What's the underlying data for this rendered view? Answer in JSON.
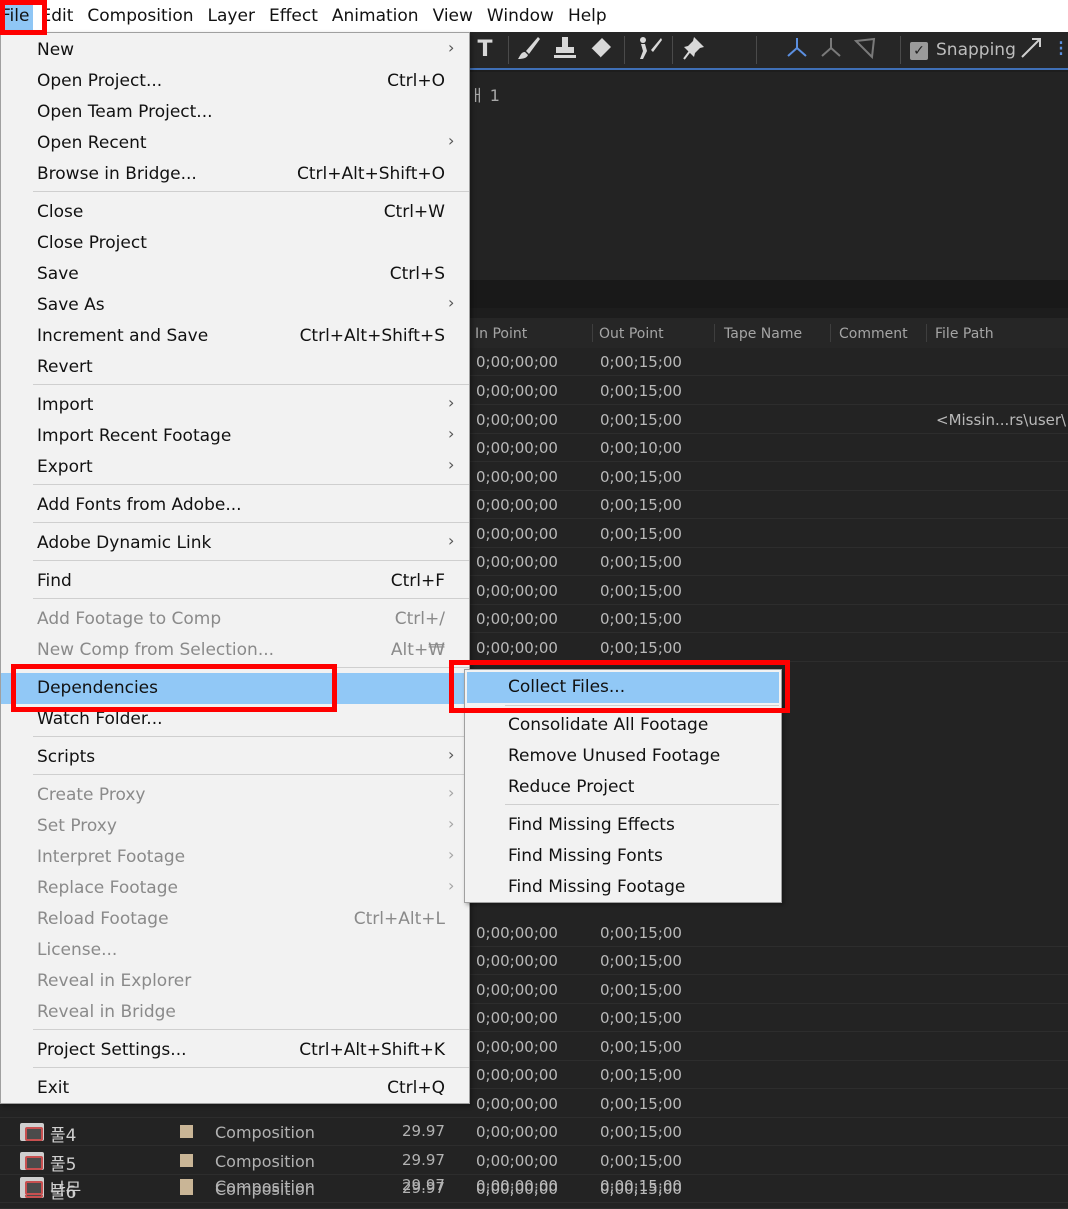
{
  "menubar": [
    "File",
    "Edit",
    "Composition",
    "Layer",
    "Effect",
    "Animation",
    "View",
    "Window",
    "Help"
  ],
  "toolbar": {
    "snapping_label": "Snapping",
    "icons": [
      "type-tool-icon",
      "brush-tool-icon",
      "clone-stamp-tool-icon",
      "eraser-tool-icon",
      "roto-brush-tool-icon",
      "puppet-pin-tool-icon",
      "axis-world-icon",
      "axis-local-icon",
      "axis-view-icon",
      "snapping-checkbox-icon",
      "snap-edges-icon"
    ]
  },
  "comp_panel": {
    "title": "ㅐ 1"
  },
  "table": {
    "headers": {
      "in_point": "In Point",
      "out_point": "Out Point",
      "tape_name": "Tape Name",
      "comment": "Comment",
      "file_path": "File Path"
    },
    "rows": [
      {
        "in": "0;00;00;00",
        "out": "0;00;15;00"
      },
      {
        "in": "0;00;00;00",
        "out": "0;00;15;00"
      },
      {
        "in": "0;00;00;00",
        "out": "0;00;15;00",
        "file_path": "<Missin...rs\\user\\"
      },
      {
        "in": "0;00;00;00",
        "out": "0;00;10;00"
      },
      {
        "in": "0;00;00;00",
        "out": "0;00;15;00"
      },
      {
        "in": "0;00;00;00",
        "out": "0;00;15;00"
      },
      {
        "in": "0;00;00;00",
        "out": "0;00;15;00"
      },
      {
        "in": "0;00;00;00",
        "out": "0;00;15;00"
      },
      {
        "in": "0;00;00;00",
        "out": "0;00;15;00"
      },
      {
        "in": "0;00;00;00",
        "out": "0;00;15;00"
      },
      {
        "in": "0;00;00;00",
        "out": "0;00;15;00"
      }
    ],
    "lower_rows": [
      {
        "in": "0;00;00;00",
        "out": "0;00;15;00"
      },
      {
        "in": "0;00;00;00",
        "out": "0;00;15;00"
      },
      {
        "in": "0;00;00;00",
        "out": "0;00;15;00"
      },
      {
        "in": "0;00;00;00",
        "out": "0;00;15;00"
      },
      {
        "in": "0;00;00;00",
        "out": "0;00;15;00"
      },
      {
        "in": "0;00;00;00",
        "out": "0;00;15;00"
      },
      {
        "in": "0;00;00;00",
        "out": "0;00;15;00"
      }
    ],
    "bottom_rows": [
      {
        "name": "풀4",
        "type": "Composition",
        "fps": "29.97",
        "in": "0;00;00;00",
        "out": "0;00;15;00"
      },
      {
        "name": "풀5",
        "type": "Composition",
        "fps": "29.97",
        "in": "0;00;00;00",
        "out": "0;00;15;00"
      },
      {
        "name": "풀6",
        "type": "Composition",
        "fps": "29.97",
        "in": "0;00;00;00",
        "out": "0;00;15;00"
      },
      {
        "name": "나무",
        "type": "Composition",
        "fps": "29.97",
        "in": "0;00;00;00",
        "out": "0;00;15;00"
      }
    ]
  },
  "file_menu": {
    "items": [
      {
        "label": "New",
        "shortcut": "",
        "submenu": true,
        "disabled": false
      },
      {
        "label": "Open Project...",
        "shortcut": "Ctrl+O",
        "submenu": false,
        "disabled": false
      },
      {
        "label": "Open Team Project...",
        "shortcut": "",
        "submenu": false,
        "disabled": false
      },
      {
        "label": "Open Recent",
        "shortcut": "",
        "submenu": true,
        "disabled": false
      },
      {
        "label": "Browse in Bridge...",
        "shortcut": "Ctrl+Alt+Shift+O",
        "submenu": false,
        "disabled": false
      },
      {
        "label": "Close",
        "shortcut": "Ctrl+W",
        "submenu": false,
        "disabled": false
      },
      {
        "label": "Close Project",
        "shortcut": "",
        "submenu": false,
        "disabled": false
      },
      {
        "label": "Save",
        "shortcut": "Ctrl+S",
        "submenu": false,
        "disabled": false
      },
      {
        "label": "Save As",
        "shortcut": "",
        "submenu": true,
        "disabled": false
      },
      {
        "label": "Increment and Save",
        "shortcut": "Ctrl+Alt+Shift+S",
        "submenu": false,
        "disabled": false
      },
      {
        "label": "Revert",
        "shortcut": "",
        "submenu": false,
        "disabled": false
      },
      {
        "label": "Import",
        "shortcut": "",
        "submenu": true,
        "disabled": false
      },
      {
        "label": "Import Recent Footage",
        "shortcut": "",
        "submenu": true,
        "disabled": false
      },
      {
        "label": "Export",
        "shortcut": "",
        "submenu": true,
        "disabled": false
      },
      {
        "label": "Add Fonts from Adobe...",
        "shortcut": "",
        "submenu": false,
        "disabled": false
      },
      {
        "label": "Adobe Dynamic Link",
        "shortcut": "",
        "submenu": true,
        "disabled": false
      },
      {
        "label": "Find",
        "shortcut": "Ctrl+F",
        "submenu": false,
        "disabled": false
      },
      {
        "label": "Add Footage to Comp",
        "shortcut": "Ctrl+/",
        "submenu": false,
        "disabled": true
      },
      {
        "label": "New Comp from Selection...",
        "shortcut": "Alt+₩",
        "submenu": false,
        "disabled": true
      },
      {
        "label": "Dependencies",
        "shortcut": "",
        "submenu": true,
        "disabled": false,
        "highlighted": true
      },
      {
        "label": "Watch Folder...",
        "shortcut": "",
        "submenu": false,
        "disabled": false
      },
      {
        "label": "Scripts",
        "shortcut": "",
        "submenu": true,
        "disabled": false
      },
      {
        "label": "Create Proxy",
        "shortcut": "",
        "submenu": true,
        "disabled": true
      },
      {
        "label": "Set Proxy",
        "shortcut": "",
        "submenu": true,
        "disabled": true
      },
      {
        "label": "Interpret Footage",
        "shortcut": "",
        "submenu": true,
        "disabled": true
      },
      {
        "label": "Replace Footage",
        "shortcut": "",
        "submenu": true,
        "disabled": true
      },
      {
        "label": "Reload Footage",
        "shortcut": "Ctrl+Alt+L",
        "submenu": false,
        "disabled": true
      },
      {
        "label": "License...",
        "shortcut": "",
        "submenu": false,
        "disabled": true
      },
      {
        "label": "Reveal in Explorer",
        "shortcut": "",
        "submenu": false,
        "disabled": true
      },
      {
        "label": "Reveal in Bridge",
        "shortcut": "",
        "submenu": false,
        "disabled": true
      },
      {
        "label": "Project Settings...",
        "shortcut": "Ctrl+Alt+Shift+K",
        "submenu": false,
        "disabled": false
      },
      {
        "label": "Exit",
        "shortcut": "Ctrl+Q",
        "submenu": false,
        "disabled": false
      }
    ]
  },
  "dependencies_submenu": {
    "items": [
      {
        "label": "Collect Files...",
        "highlighted": true
      },
      {
        "label": "Consolidate All Footage"
      },
      {
        "label": "Remove Unused Footage"
      },
      {
        "label": "Reduce Project"
      },
      {
        "label": "Find Missing Effects"
      },
      {
        "label": "Find Missing Fonts"
      },
      {
        "label": "Find Missing Footage"
      }
    ]
  },
  "colors": {
    "menu_bg": "#f2f2f2",
    "highlight": "#91c8f6",
    "annotation_red": "#ff0000",
    "panel_bg": "#232323"
  }
}
